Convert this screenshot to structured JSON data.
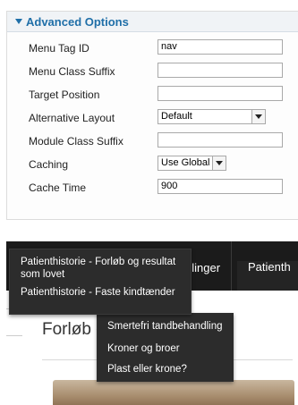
{
  "panel": {
    "title": "Advanced Options",
    "fields": {
      "menu_tag_id": {
        "label": "Menu Tag ID",
        "value": "nav"
      },
      "menu_class_suffix": {
        "label": "Menu Class Suffix",
        "value": ""
      },
      "target_position": {
        "label": "Target Position",
        "value": ""
      },
      "alternative_layout": {
        "label": "Alternative Layout",
        "value": "Default"
      },
      "module_class_suffix": {
        "label": "Module Class Suffix",
        "value": ""
      },
      "caching": {
        "label": "Caching",
        "value": "Use Global"
      },
      "cache_time": {
        "label": "Cache Time",
        "value": "900"
      }
    }
  },
  "site": {
    "nav": {
      "behandlinger": "dlinger",
      "patient": "Patienth"
    },
    "dropdown_primary": [
      "Patienthistorie - Forløb og resultat som lovet",
      "Patienthistorie - Faste kindtænder"
    ],
    "dropdown_secondary": [
      "Smertefri tandbehandling",
      "Kroner og broer",
      "Plast eller krone?"
    ],
    "page_heading": "Forløb o"
  },
  "colors": {
    "accent": "#1f6fa8",
    "nav_bg": "#1b1b1b",
    "dropdown_bg": "#2c2c2c"
  }
}
